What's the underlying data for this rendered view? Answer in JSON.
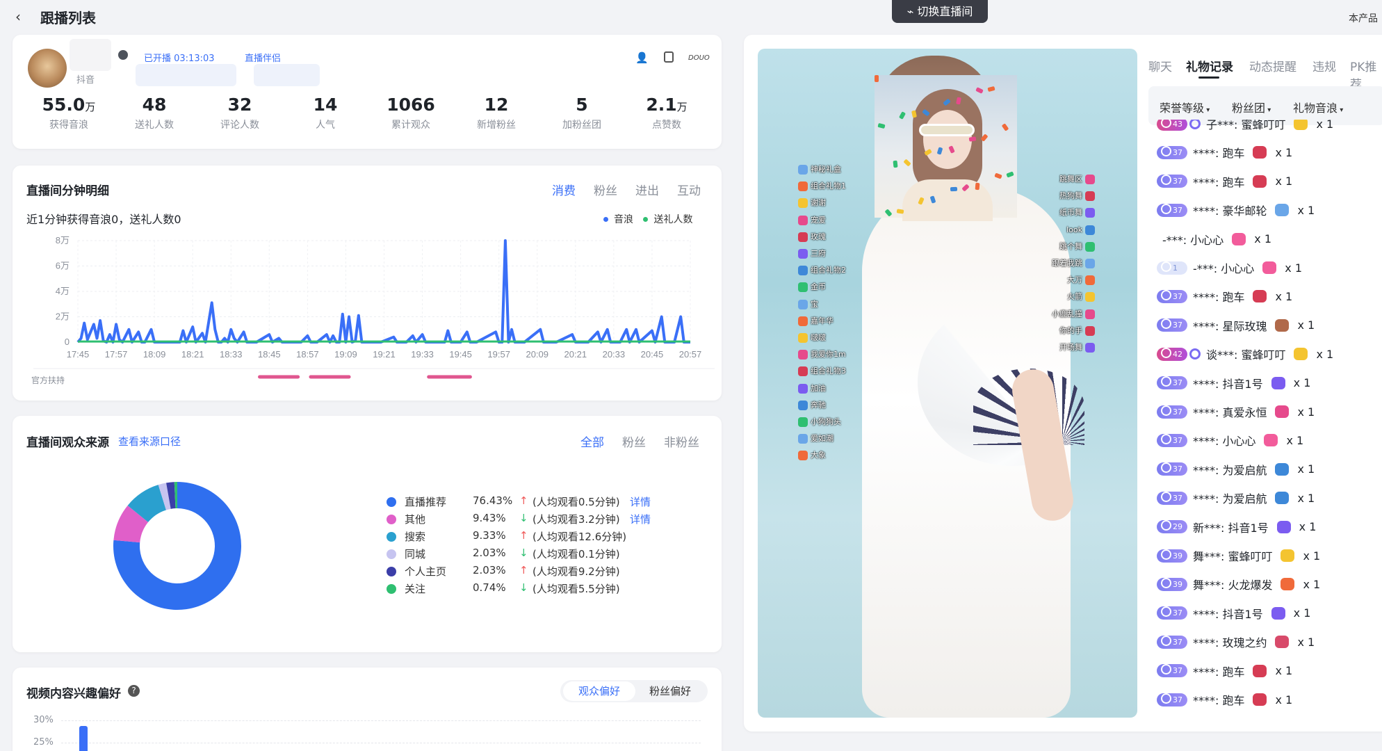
{
  "header": {
    "back_icon": "‹",
    "title": "跟播列表",
    "switch_room": "切换直播间",
    "right_text": "本产品"
  },
  "streamer": {
    "live_duration": "已开播 03:13:03",
    "companion": "直播伴侣",
    "platform": "抖音",
    "icons": [
      "person-icon",
      "document-icon",
      "douyin-logo-icon"
    ],
    "douyin_text": "DOUO"
  },
  "stats": [
    {
      "value": "55.0",
      "unit": "万",
      "label": "获得音浪"
    },
    {
      "value": "48",
      "unit": "",
      "label": "送礼人数"
    },
    {
      "value": "32",
      "unit": "",
      "label": "评论人数"
    },
    {
      "value": "14",
      "unit": "",
      "label": "人气"
    },
    {
      "value": "1066",
      "unit": "",
      "label": "累计观众"
    },
    {
      "value": "12",
      "unit": "",
      "label": "新增粉丝"
    },
    {
      "value": "5",
      "unit": "",
      "label": "加粉丝团"
    },
    {
      "value": "2.1",
      "unit": "万",
      "label": "点赞数"
    }
  ],
  "minute_detail": {
    "title": "直播间分钟明细",
    "tabs": [
      "消费",
      "粉丝",
      "进出",
      "互动"
    ],
    "active_tab": 0,
    "summary": "近1分钟获得音浪0，送礼人数0",
    "legend": [
      {
        "name": "音浪",
        "color": "#3a6ff7"
      },
      {
        "name": "送礼人数",
        "color": "#2fbf71"
      }
    ],
    "official_label": "官方扶持"
  },
  "chart_data": {
    "type": "line",
    "title": "",
    "y_ticks": [
      "8万",
      "6万",
      "4万",
      "2万",
      "0"
    ],
    "ylim": [
      0,
      80000
    ],
    "x_ticks": [
      "17:45",
      "17:57",
      "18:09",
      "18:21",
      "18:33",
      "18:45",
      "18:57",
      "19:09",
      "19:21",
      "19:33",
      "19:45",
      "19:57",
      "20:09",
      "20:21",
      "20:33",
      "20:45",
      "20:57"
    ],
    "x_range_minutes": [
      0,
      192
    ],
    "series": [
      {
        "name": "音浪",
        "color": "#3a6ff7",
        "points": [
          [
            0,
            0
          ],
          [
            1,
            3000
          ],
          [
            2,
            15000
          ],
          [
            3,
            2000
          ],
          [
            5,
            14000
          ],
          [
            6,
            3000
          ],
          [
            7,
            17000
          ],
          [
            8,
            1000
          ],
          [
            9,
            0
          ],
          [
            10,
            6000
          ],
          [
            11,
            0
          ],
          [
            12,
            14000
          ],
          [
            13,
            2000
          ],
          [
            14,
            0
          ],
          [
            16,
            10000
          ],
          [
            17,
            0
          ],
          [
            19,
            8000
          ],
          [
            20,
            0
          ],
          [
            21,
            0
          ],
          [
            23,
            10000
          ],
          [
            24,
            0
          ],
          [
            28,
            0
          ],
          [
            32,
            0
          ],
          [
            33,
            9000
          ],
          [
            34,
            0
          ],
          [
            36,
            12000
          ],
          [
            37,
            0
          ],
          [
            39,
            7000
          ],
          [
            40,
            0
          ],
          [
            42,
            31000
          ],
          [
            43,
            10000
          ],
          [
            44,
            0
          ],
          [
            45,
            0
          ],
          [
            46,
            3000
          ],
          [
            47,
            0
          ],
          [
            48,
            10000
          ],
          [
            49,
            3000
          ],
          [
            50,
            0
          ],
          [
            52,
            8000
          ],
          [
            53,
            0
          ],
          [
            56,
            0
          ],
          [
            60,
            6000
          ],
          [
            61,
            0
          ],
          [
            63,
            3000
          ],
          [
            64,
            0
          ],
          [
            70,
            0
          ],
          [
            72,
            5000
          ],
          [
            73,
            0
          ],
          [
            75,
            0
          ],
          [
            78,
            6000
          ],
          [
            79,
            0
          ],
          [
            80,
            5000
          ],
          [
            81,
            0
          ],
          [
            82,
            0
          ],
          [
            83,
            22000
          ],
          [
            84,
            0
          ],
          [
            85,
            20000
          ],
          [
            86,
            0
          ],
          [
            87,
            1000
          ],
          [
            88,
            21000
          ],
          [
            89,
            0
          ],
          [
            95,
            0
          ],
          [
            99,
            4000
          ],
          [
            100,
            0
          ],
          [
            103,
            0
          ],
          [
            105,
            5000
          ],
          [
            106,
            0
          ],
          [
            108,
            6000
          ],
          [
            109,
            0
          ],
          [
            115,
            0
          ],
          [
            116,
            9000
          ],
          [
            117,
            0
          ],
          [
            120,
            0
          ],
          [
            122,
            8000
          ],
          [
            123,
            0
          ],
          [
            125,
            0
          ],
          [
            131,
            8000
          ],
          [
            132,
            0
          ],
          [
            133,
            0
          ],
          [
            134,
            80000
          ],
          [
            135,
            0
          ],
          [
            136,
            10000
          ],
          [
            137,
            0
          ],
          [
            140,
            0
          ],
          [
            145,
            10000
          ],
          [
            146,
            0
          ],
          [
            150,
            0
          ],
          [
            155,
            6000
          ],
          [
            156,
            0
          ],
          [
            160,
            0
          ],
          [
            163,
            8000
          ],
          [
            164,
            0
          ],
          [
            166,
            10000
          ],
          [
            167,
            0
          ],
          [
            170,
            0
          ],
          [
            172,
            10000
          ],
          [
            173,
            0
          ],
          [
            175,
            10000
          ],
          [
            176,
            0
          ],
          [
            180,
            9000
          ],
          [
            181,
            0
          ],
          [
            183,
            20000
          ],
          [
            184,
            0
          ],
          [
            187,
            0
          ],
          [
            189,
            20000
          ],
          [
            190,
            0
          ],
          [
            192,
            0
          ]
        ]
      },
      {
        "name": "送礼人数",
        "color": "#2fbf71",
        "points": [
          [
            0,
            500
          ],
          [
            192,
            500
          ]
        ]
      }
    ],
    "official_support_ranges": [
      [
        57,
        69
      ],
      [
        73,
        85
      ],
      [
        110,
        123
      ]
    ],
    "grid": true,
    "legend": "top-right"
  },
  "audience_source": {
    "title": "直播间观众来源",
    "link": "查看来源口径",
    "tabs": [
      "全部",
      "粉丝",
      "非粉丝"
    ],
    "active_tab": 0,
    "items": [
      {
        "name": "直播推荐",
        "percent": "76.43%",
        "value": 76.43,
        "arrow": "↑",
        "arrow_color": "#f05b5b",
        "avg": "(人均观看0.5分钟)",
        "detail": "详情",
        "color": "#2f6fef"
      },
      {
        "name": "其他",
        "percent": "9.43%",
        "value": 9.43,
        "arrow": "↓",
        "arrow_color": "#2fbf71",
        "avg": "(人均观看3.2分钟)",
        "detail": "详情",
        "color": "#e05fc9"
      },
      {
        "name": "搜索",
        "percent": "9.33%",
        "value": 9.33,
        "arrow": "↑",
        "arrow_color": "#f05b5b",
        "avg": "(人均观看12.6分钟)",
        "detail": "",
        "color": "#2aa0cf"
      },
      {
        "name": "同城",
        "percent": "2.03%",
        "value": 2.03,
        "arrow": "↓",
        "arrow_color": "#2fbf71",
        "avg": "(人均观看0.1分钟)",
        "detail": "",
        "color": "#c6c4f0"
      },
      {
        "name": "个人主页",
        "percent": "2.03%",
        "value": 2.03,
        "arrow": "↑",
        "arrow_color": "#f05b5b",
        "avg": "(人均观看9.2分钟)",
        "detail": "",
        "color": "#3b3ea8"
      },
      {
        "name": "关注",
        "percent": "0.74%",
        "value": 0.74,
        "arrow": "↓",
        "arrow_color": "#2fbf71",
        "avg": "(人均观看5.5分钟)",
        "detail": "",
        "color": "#2fbf71"
      }
    ]
  },
  "interest": {
    "title": "视频内容兴趣偏好",
    "help_icon": "?",
    "toggle": [
      "观众偏好",
      "粉丝偏好"
    ],
    "active": 0,
    "y_ticks": [
      "30%",
      "25%"
    ]
  },
  "video": {
    "left_list": [
      "神秘礼盒",
      "组合礼物1",
      "谢谢",
      "宠爱",
      "玫瑰",
      "三府",
      "组合礼物2",
      "金币",
      "宝",
      "嘉年华",
      "啵啵",
      "我爱你1m",
      "组合礼物3",
      "加油",
      "奔驰",
      "小狗狗头",
      "爱如潮",
      "大象"
    ],
    "right_list": [
      "跳舞区",
      "热狗舞",
      "纸币舞",
      "look",
      "跳个舞",
      "跟着我跳",
      "大万",
      "火箭",
      "小鹿乱撞",
      "你的手",
      "开场舞"
    ]
  },
  "chat": {
    "tabs": [
      "聊天",
      "礼物记录",
      "动态提醒",
      "违规",
      "PK推荐"
    ],
    "active_tab": 1,
    "filters": [
      "荣誉等级",
      "粉丝团",
      "礼物音浪"
    ],
    "gifts": [
      {
        "level": "43",
        "badge": "red",
        "ring": true,
        "user": "子***: 蜜蜂叮叮",
        "gift_color": "#f4c430",
        "count": "x 1"
      },
      {
        "level": "37",
        "badge": "",
        "ring": false,
        "user": "****: 跑车",
        "gift_color": "#d63c54",
        "count": "x 1"
      },
      {
        "level": "37",
        "badge": "",
        "ring": false,
        "user": "****: 跑车",
        "gift_color": "#d63c54",
        "count": "x 1"
      },
      {
        "level": "37",
        "badge": "",
        "ring": false,
        "user": "****: 豪华邮轮",
        "gift_color": "#6aa6e8",
        "count": "x 1"
      },
      {
        "level": "",
        "badge": "none",
        "ring": false,
        "user": "-***: 小心心",
        "gift_color": "#f25c9b",
        "count": "x 1"
      },
      {
        "level": "1",
        "badge": "light",
        "ring": false,
        "user": "-***: 小心心",
        "gift_color": "#f25c9b",
        "count": "x 1"
      },
      {
        "level": "37",
        "badge": "",
        "ring": false,
        "user": "****: 跑车",
        "gift_color": "#d63c54",
        "count": "x 1"
      },
      {
        "level": "37",
        "badge": "",
        "ring": false,
        "user": "****: 星际玫瑰",
        "gift_color": "#b0694a",
        "count": "x 1"
      },
      {
        "level": "42",
        "badge": "red",
        "ring": true,
        "user": "谈***: 蜜蜂叮叮",
        "gift_color": "#f4c430",
        "count": "x 1"
      },
      {
        "level": "37",
        "badge": "",
        "ring": false,
        "user": "****: 抖音1号",
        "gift_color": "#7b5cf0",
        "count": "x 1"
      },
      {
        "level": "37",
        "badge": "",
        "ring": false,
        "user": "****: 真爱永恒",
        "gift_color": "#e64a8c",
        "count": "x 1"
      },
      {
        "level": "37",
        "badge": "",
        "ring": false,
        "user": "****: 小心心",
        "gift_color": "#f25c9b",
        "count": "x 1"
      },
      {
        "level": "37",
        "badge": "",
        "ring": false,
        "user": "****: 为爱启航",
        "gift_color": "#3d88d8",
        "count": "x 1"
      },
      {
        "level": "37",
        "badge": "",
        "ring": false,
        "user": "****: 为爱启航",
        "gift_color": "#3d88d8",
        "count": "x 1"
      },
      {
        "level": "29",
        "badge": "",
        "ring": false,
        "user": "新***: 抖音1号",
        "gift_color": "#7b5cf0",
        "count": "x 1"
      },
      {
        "level": "39",
        "badge": "",
        "ring": false,
        "user": "舞***: 蜜蜂叮叮",
        "gift_color": "#f4c430",
        "count": "x 1"
      },
      {
        "level": "39",
        "badge": "",
        "ring": false,
        "user": "舞***: 火龙爆发",
        "gift_color": "#f06a3a",
        "count": "x 1"
      },
      {
        "level": "37",
        "badge": "",
        "ring": false,
        "user": "****: 抖音1号",
        "gift_color": "#7b5cf0",
        "count": "x 1"
      },
      {
        "level": "37",
        "badge": "",
        "ring": false,
        "user": "****: 玫瑰之约",
        "gift_color": "#d84a6a",
        "count": "x 1"
      },
      {
        "level": "37",
        "badge": "",
        "ring": false,
        "user": "****: 跑车",
        "gift_color": "#d63c54",
        "count": "x 1"
      },
      {
        "level": "37",
        "badge": "",
        "ring": false,
        "user": "****: 跑车",
        "gift_color": "#d63c54",
        "count": "x 1"
      }
    ]
  }
}
